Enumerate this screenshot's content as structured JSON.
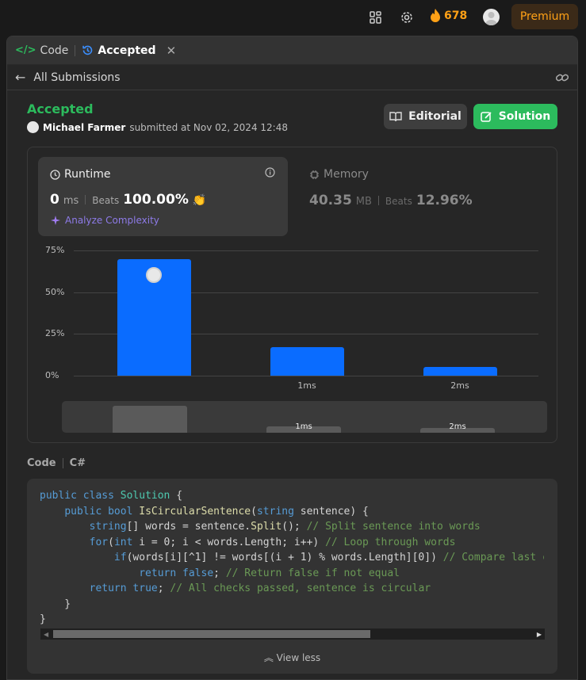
{
  "topnav": {
    "streak_count": "678",
    "premium_label": "Premium"
  },
  "tabs": {
    "code_label": "Code",
    "accepted_label": "Accepted"
  },
  "subbar": {
    "back_label": "All Submissions"
  },
  "submission": {
    "status": "Accepted",
    "user": "Michael Farmer",
    "submitted_text": "submitted at Nov 02, 2024 12:48"
  },
  "buttons": {
    "editorial": "Editorial",
    "solution": "Solution"
  },
  "runtime": {
    "title": "Runtime",
    "value": "0",
    "unit": "ms",
    "beats_label": "Beats",
    "beats_value": "100.00%",
    "analyze_label": "Analyze Complexity"
  },
  "memory": {
    "title": "Memory",
    "value": "40.35",
    "unit": "MB",
    "beats_label": "Beats",
    "beats_value": "12.96%"
  },
  "chart_data": {
    "type": "bar",
    "categories": [
      "",
      "1ms",
      "2ms"
    ],
    "values": [
      70,
      17,
      5
    ],
    "ylim": [
      0,
      75
    ],
    "yticks": [
      "75%",
      "50%",
      "25%",
      "0%"
    ],
    "grid": true,
    "accent": "#0a6cff",
    "overview_values": [
      16,
      4,
      3
    ],
    "overview_labels": [
      "",
      "1ms",
      "2ms"
    ]
  },
  "code_section": {
    "label": "Code",
    "language": "C#",
    "view_less": "View less"
  },
  "colors": {
    "accepted": "#2cbb5d",
    "brand": "#ffa116",
    "bar": "#0a6cff"
  }
}
